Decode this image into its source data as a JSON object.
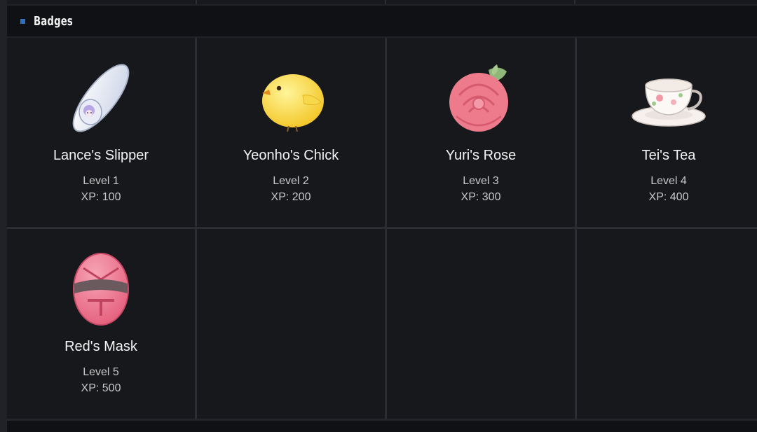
{
  "section": {
    "title": "Badges"
  },
  "badges": [
    {
      "name": "Lance's Slipper",
      "level": "Level 1",
      "xp": "XP: 100",
      "icon": "slipper-icon"
    },
    {
      "name": "Yeonho's Chick",
      "level": "Level 2",
      "xp": "XP: 200",
      "icon": "chick-icon"
    },
    {
      "name": "Yuri's Rose",
      "level": "Level 3",
      "xp": "XP: 300",
      "icon": "rose-icon"
    },
    {
      "name": "Tei's Tea",
      "level": "Level 4",
      "xp": "XP: 400",
      "icon": "teacup-icon"
    },
    {
      "name": "Red's Mask",
      "level": "Level 5",
      "xp": "XP: 500",
      "icon": "mask-icon"
    }
  ],
  "colors": {
    "accent": "#2d6fc0",
    "panel": "#17181c",
    "header": "#101114"
  }
}
